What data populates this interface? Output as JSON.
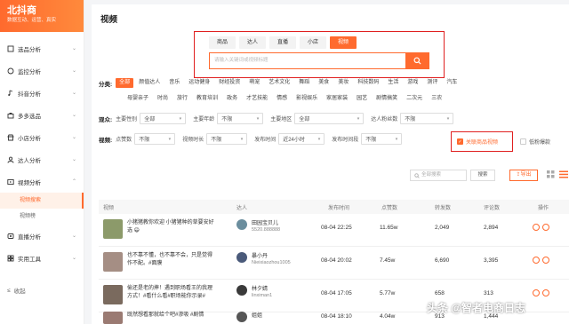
{
  "brand": {
    "title": "北抖商",
    "subtitle": "数据互动、运营、真实"
  },
  "sidebar": {
    "items": [
      {
        "label": "选品分析",
        "icon": "cube-icon"
      },
      {
        "label": "监控分析",
        "icon": "monitor-icon"
      },
      {
        "label": "抖音分析",
        "icon": "music-icon"
      },
      {
        "label": "多多选品",
        "icon": "bag-icon"
      },
      {
        "label": "小店分析",
        "icon": "shop-icon"
      },
      {
        "label": "达人分析",
        "icon": "user-icon"
      },
      {
        "label": "视频分析",
        "icon": "video-icon",
        "children": [
          "视频搜索",
          "视频榜"
        ]
      },
      {
        "label": "直播分析",
        "icon": "live-icon"
      },
      {
        "label": "实用工具",
        "icon": "tool-icon"
      }
    ],
    "collapse": "收起"
  },
  "page": {
    "title": "视频"
  },
  "search": {
    "tabs": [
      "商品",
      "达人",
      "直播",
      "小店",
      "视频"
    ],
    "active_tab": 4,
    "placeholder": "请输入关键词或视频标题"
  },
  "filters": {
    "category_label": "分类:",
    "categories_row1": [
      "全部",
      "颜值达人",
      "音乐",
      "运动健身",
      "财经投资",
      "萌宠",
      "艺术文化",
      "舞蹈",
      "美食",
      "美妆",
      "科技数码",
      "生活",
      "游戏",
      "测评",
      "汽车"
    ],
    "categories_row2": [
      "母婴亲子",
      "时尚",
      "旅行",
      "教育培训",
      "政务",
      "才艺技能",
      "情感",
      "影视娱乐",
      "家居家装",
      "园艺",
      "剧情搞笑",
      "二次元",
      "三农"
    ],
    "audience_label": "观众:",
    "audience_fields": [
      {
        "label": "主要性别",
        "value": "全部"
      },
      {
        "label": "主要年龄",
        "value": "不限"
      },
      {
        "label": "主要地区",
        "value": "全部"
      },
      {
        "label": "达人粉丝数",
        "value": "不限"
      }
    ],
    "video_label": "视频:",
    "video_fields": [
      {
        "label": "点赞数",
        "value": "不限"
      },
      {
        "label": "视频时长",
        "value": "不限"
      },
      {
        "label": "发布时间",
        "value": "近24小时"
      },
      {
        "label": "发布时间段",
        "value": "不限"
      }
    ],
    "product_related": "关联商品视频",
    "low_fans": "低粉爆款"
  },
  "toolbar": {
    "search_placeholder": "全部搜索",
    "search_button": "搜索",
    "export": "导出"
  },
  "table": {
    "headers": [
      "视频",
      "达人",
      "发布时间",
      "点赞数",
      "转发数",
      "评论数",
      "操作"
    ],
    "rows": [
      {
        "title": "小猪猪教你欢迎 小猪猪种的草要安好选 😄",
        "author": "田园宝贝儿",
        "author_id": "5520.888888",
        "time": "08-04 22:25",
        "likes": "11.65w",
        "shares": "2,049",
        "comments": "2,894",
        "thumb_color": "#8c9a6a",
        "avatar_color": "#6b8e9e"
      },
      {
        "title": "也不靠不懂，也不靠不会，只是觉得作不配。#面膜",
        "author": "暴小丹",
        "author_id": "Nieixiaozhou1005",
        "time": "08-04 20:02",
        "likes": "7.45w",
        "shares": "6,690",
        "comments": "3,395",
        "thumb_color": "#a58e84",
        "avatar_color": "#4a5a7a"
      },
      {
        "title": "偷还是老的摔！遇到职场看王的我理方式！#看什么看#职场能你示录#",
        "author": "林夕婧",
        "author_id": "linximan1",
        "time": "08-04 17:05",
        "likes": "5.77w",
        "shares": "658",
        "comments": "313",
        "thumb_color": "#7a6a5e",
        "avatar_color": "#3a3a3a"
      },
      {
        "title": "既然想看那就给个吧#渗吸 #剧情",
        "author": "姐姐",
        "author_id": "",
        "time": "08-04 18:10",
        "likes": "4.04w",
        "shares": "913",
        "comments": "1,444",
        "thumb_color": "#9a7a72",
        "avatar_color": "#555555"
      }
    ]
  },
  "watermark": "头条 @智者电商日志",
  "colors": {
    "accent": "#ff6a2e",
    "highlight_border": "#e02020"
  }
}
